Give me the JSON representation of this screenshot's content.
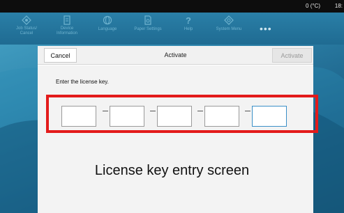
{
  "status_bar": {
    "temperature": "0 (°C)",
    "time": "18:"
  },
  "menu_bar": {
    "items": [
      {
        "label": "Job Status/\nCancel",
        "icon": "job-status-icon"
      },
      {
        "label": "Device\nInformation",
        "icon": "device-info-icon"
      },
      {
        "label": "Language",
        "icon": "language-icon"
      },
      {
        "label": "Paper Settings",
        "icon": "paper-settings-icon"
      },
      {
        "label": "Help",
        "icon": "help-icon"
      },
      {
        "label": "System Menu",
        "icon": "system-menu-icon"
      }
    ],
    "more": "•••"
  },
  "dialog": {
    "cancel_label": "Cancel",
    "title": "Activate",
    "activate_label": "Activate",
    "instruction": "Enter the license key.",
    "key_fields": [
      "",
      "",
      "",
      "",
      ""
    ]
  },
  "caption": "License key entry screen",
  "colors": {
    "highlight": "#e31b1b",
    "accent": "#3a8fc7"
  }
}
